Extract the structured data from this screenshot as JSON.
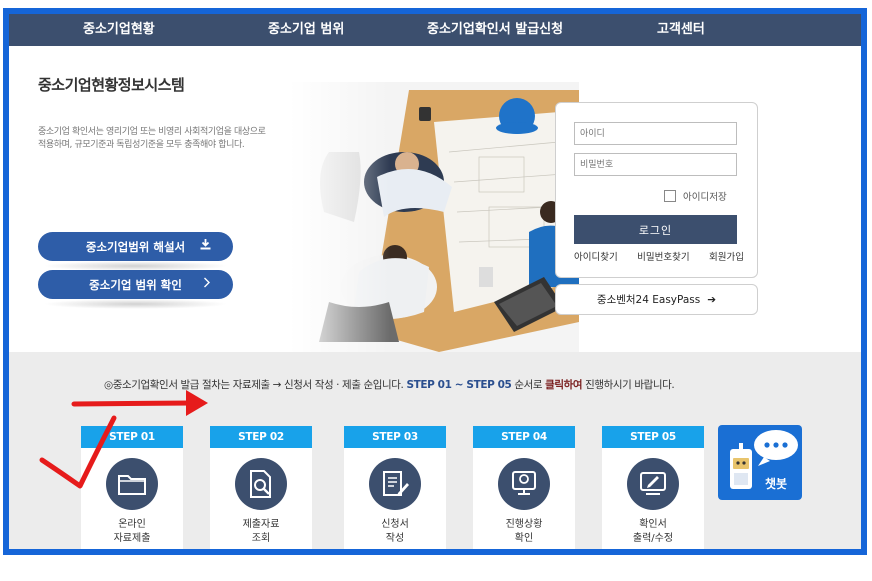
{
  "nav": {
    "items": [
      "중소기업현황",
      "중소기업 범위",
      "중소기업확인서 발급신청",
      "고객센터"
    ]
  },
  "hero": {
    "title": "중소기업현황정보시스템",
    "description": "중소기업 확인서는 영리기업 또는 비영리 사회적기업을 대상으로 적용하며, 규모기준과 독립성기준을 모두 충족해야 합니다.",
    "btn_guide": "중소기업범위 해설서",
    "btn_check": "중소기업 범위 확인"
  },
  "login": {
    "id_placeholder": "아이디",
    "pw_placeholder": "비밀번호",
    "remember_label": "아이디저장",
    "login_button": "로그인",
    "find_id": "아이디찾기",
    "find_pw": "비밀번호찾기",
    "signup": "회원가입",
    "easypass": "중소벤처24 EasyPass"
  },
  "notice": {
    "prefix": "◎중소기업확인서 발급 절차는 자료제출 → 신청서 작성 · 제출 순입니다. ",
    "steps_range": "STEP 01 ~ STEP 05",
    "middle": " 순서로 ",
    "click": "클릭하여",
    "suffix": " 진행하시기 바랍니다."
  },
  "steps": [
    {
      "tab": "STEP 01",
      "line1": "온라인",
      "line2": "자료제출",
      "icon": "folder-icon"
    },
    {
      "tab": "STEP 02",
      "line1": "제출자료",
      "line2": "조회",
      "icon": "document-search-icon"
    },
    {
      "tab": "STEP 03",
      "line1": "신청서",
      "line2": "작성",
      "icon": "form-write-icon"
    },
    {
      "tab": "STEP 04",
      "line1": "진행상황",
      "line2": "확인",
      "icon": "status-check-icon"
    },
    {
      "tab": "STEP 05",
      "line1": "확인서",
      "line2": "출력/수정",
      "icon": "certificate-print-icon"
    }
  ],
  "chatbot": {
    "label": "챗봇",
    "icon": "chatbot-robot-icon"
  },
  "colors": {
    "frame": "#1565d8",
    "nav_bg": "#3c4f6e",
    "pill_bg": "#2e5da8",
    "step_tab": "#18a2ea",
    "step_icon_bg": "#3c4f6e",
    "annotation_red": "#e61b1b"
  }
}
